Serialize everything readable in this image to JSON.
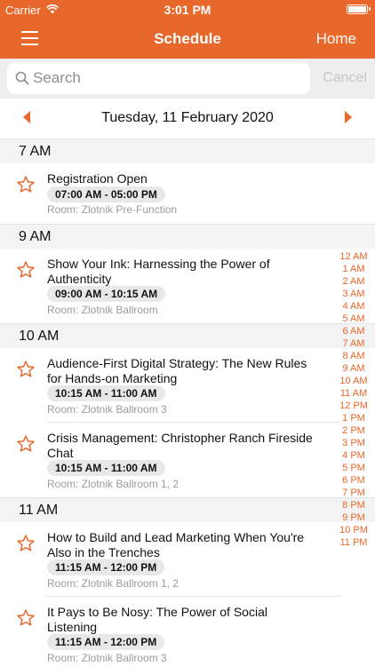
{
  "status": {
    "carrier": "Carrier",
    "time": "3:01 PM"
  },
  "header": {
    "title": "Schedule",
    "home_label": "Home"
  },
  "search": {
    "placeholder": "Search",
    "cancel_label": "Cancel"
  },
  "date_nav": {
    "date": "Tuesday, 11 February 2020"
  },
  "sections": [
    {
      "label": "7 AM",
      "items": [
        {
          "title": "Registration Open",
          "time": "07:00 AM - 05:00 PM",
          "room": "Room:  Zlotnik Pre-Function"
        }
      ]
    },
    {
      "label": "9 AM",
      "items": [
        {
          "title": "Show Your Ink: Harnessing the Power of Authenticity",
          "time": "09:00 AM - 10:15 AM",
          "room": "Room:  Zlotnik Ballroom"
        }
      ]
    },
    {
      "label": "10 AM",
      "items": [
        {
          "title": "Audience-First Digital Strategy: The New Rules for Hands-on Marketing",
          "time": "10:15 AM - 11:00 AM",
          "room": "Room:  Zlotnik Ballroom 3"
        },
        {
          "title": "Crisis Management: Christopher Ranch Fireside Chat",
          "time": "10:15 AM - 11:00 AM",
          "room": "Room:  Zlotnik Ballroom 1, 2"
        }
      ]
    },
    {
      "label": "11 AM",
      "items": [
        {
          "title": "How to Build and Lead Marketing When You're Also in the Trenches",
          "time": "11:15 AM - 12:00 PM",
          "room": "Room:  Zlotnik Ballroom 1, 2"
        },
        {
          "title": "It Pays to Be Nosy: The Power of Social Listening",
          "time": "11:15 AM - 12:00 PM",
          "room": "Room:  Zlotnik Ballroom 3"
        }
      ]
    }
  ],
  "hour_index": [
    "12 AM",
    "1 AM",
    "2 AM",
    "3 AM",
    "4 AM",
    "5 AM",
    "6 AM",
    "7 AM",
    "8 AM",
    "9 AM",
    "10 AM",
    "11 AM",
    "12 PM",
    "1 PM",
    "2 PM",
    "3 PM",
    "4 PM",
    "5 PM",
    "6 PM",
    "7 PM",
    "8 PM",
    "9 PM",
    "10 PM",
    "11 PM"
  ],
  "colors": {
    "accent": "#e8672a",
    "section_bg": "#f3f3f3",
    "pill_bg": "#e8e8e8",
    "room_text": "#9b9b9b"
  }
}
